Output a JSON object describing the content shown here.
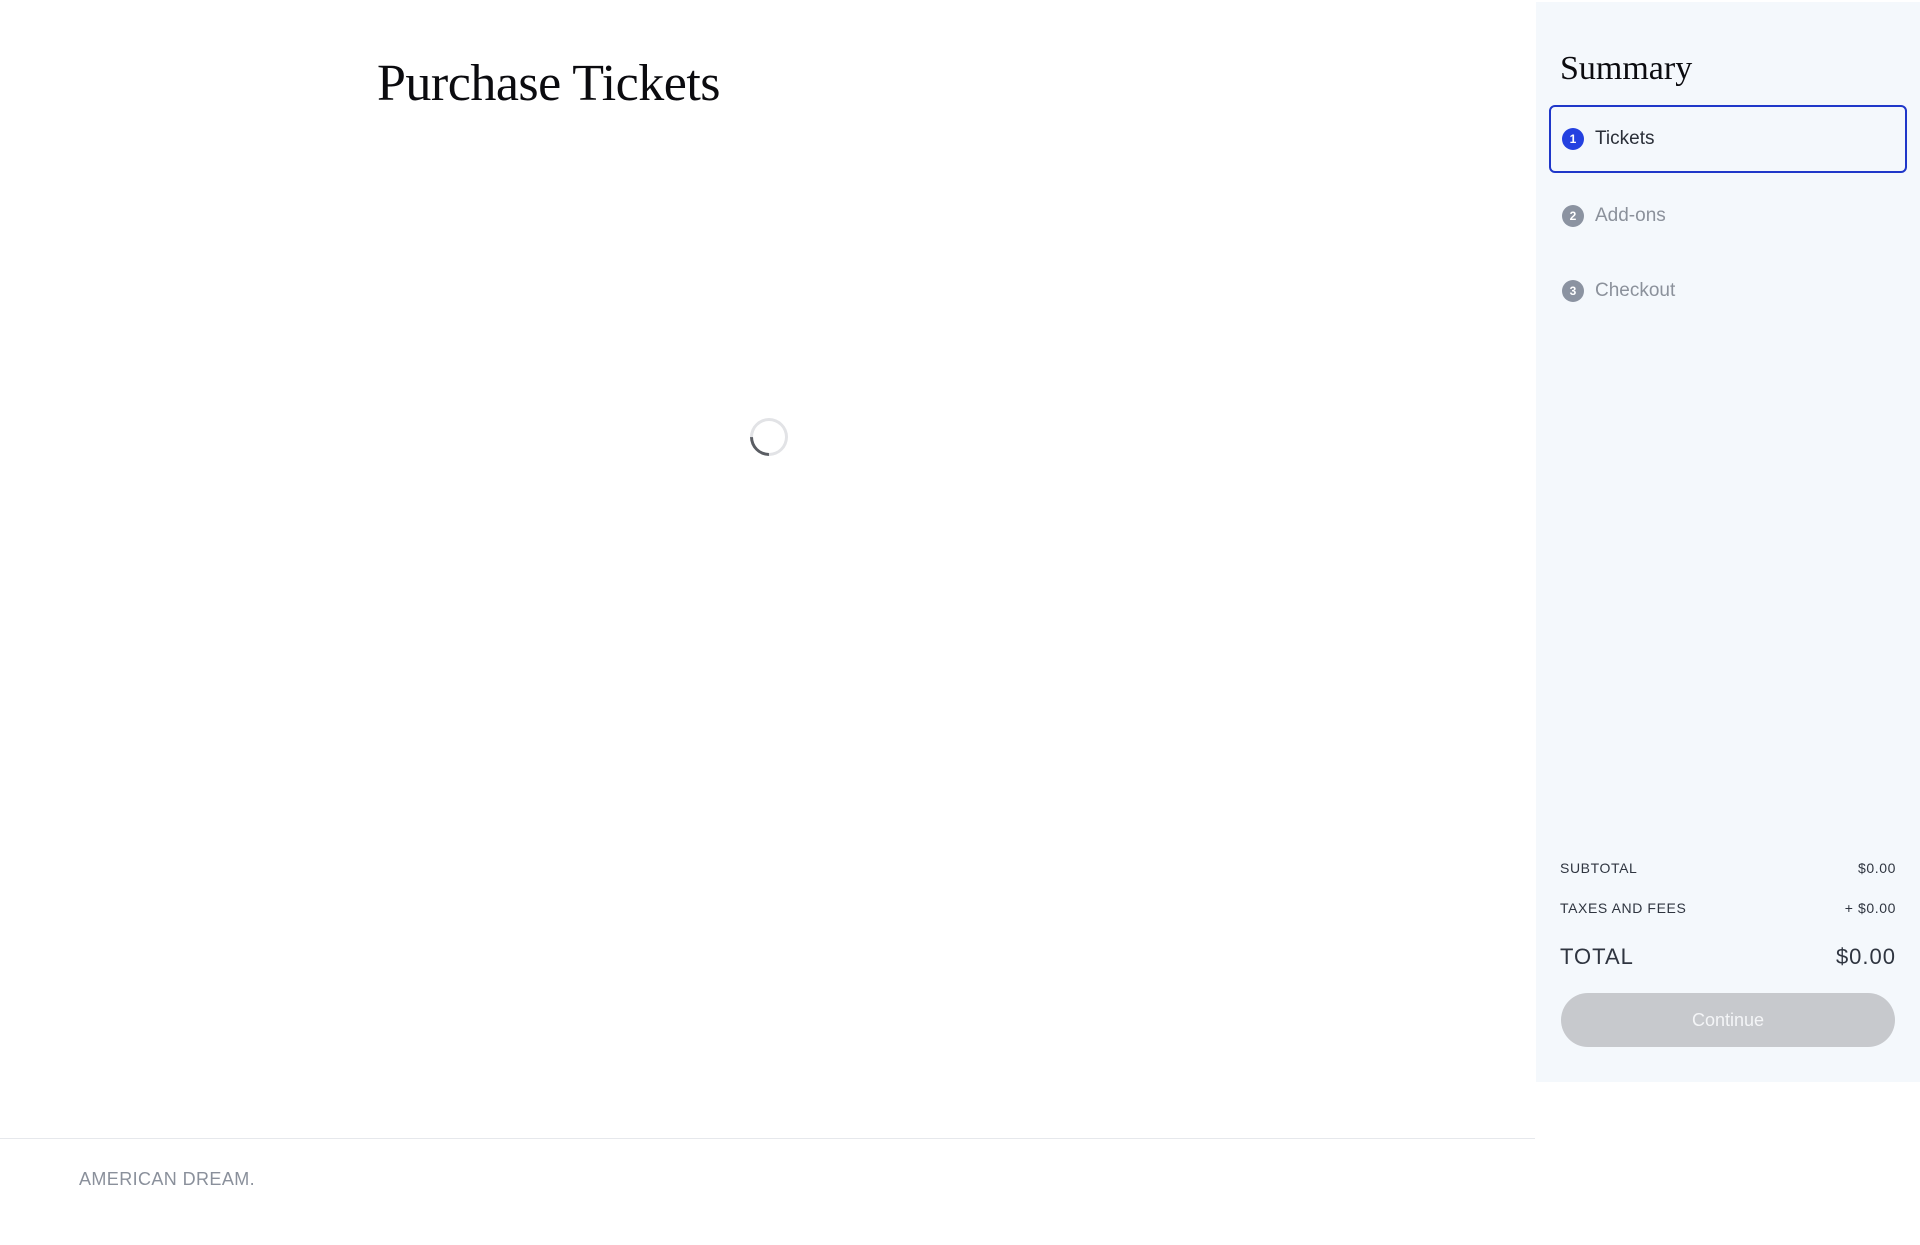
{
  "main": {
    "title": "Purchase Tickets"
  },
  "summary": {
    "title": "Summary",
    "steps": [
      {
        "number": "1",
        "label": "Tickets",
        "active": true
      },
      {
        "number": "2",
        "label": "Add-ons",
        "active": false
      },
      {
        "number": "3",
        "label": "Checkout",
        "active": false
      }
    ],
    "subtotal_label": "SUBTOTAL",
    "subtotal_value": "$0.00",
    "taxes_label": "TAXES AND FEES",
    "taxes_value": "+ $0.00",
    "total_label": "TOTAL",
    "total_value": "$0.00",
    "continue_label": "Continue"
  },
  "footer": {
    "brand": "AMERICAN DREAM."
  },
  "colors": {
    "accent": "#1f37c9",
    "step_active": "#2441e0",
    "step_inactive": "#8b93a1",
    "sidebar_bg": "#f4f8fc",
    "button_disabled": "#c7c9cd"
  },
  "icons": {
    "loading": "spinner-icon"
  }
}
